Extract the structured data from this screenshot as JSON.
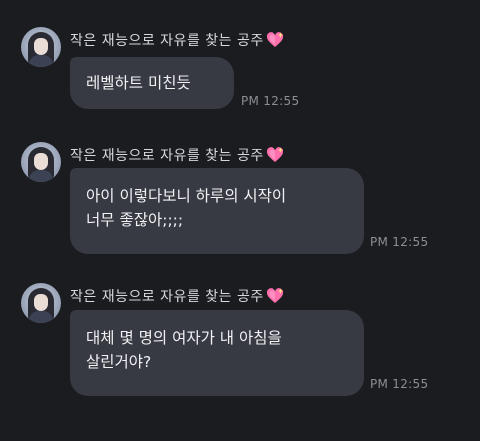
{
  "messages": [
    {
      "sender": "작은 재능으로 자유를 찾는 공주",
      "lines": [
        "레벨하트 미친듯"
      ],
      "time": "PM 12:55"
    },
    {
      "sender": "작은 재능으로 자유를 찾는 공주",
      "lines": [
        "아이 이렇다보니 하루의 시작이",
        "너무 좋잖아;;;;"
      ],
      "time": "PM 12:55"
    },
    {
      "sender": "작은 재능으로 자유를 찾는 공주",
      "lines": [
        "대체 몇 명의 여자가 내 아침을",
        "살린거야?"
      ],
      "time": "PM 12:55"
    }
  ],
  "icons": {
    "sender_badge": "sparkling-heart-icon",
    "avatar": "profile-photo"
  },
  "colors": {
    "background": "#1b1c20",
    "bubble": "#373a43",
    "heart": "#ff6fae"
  }
}
